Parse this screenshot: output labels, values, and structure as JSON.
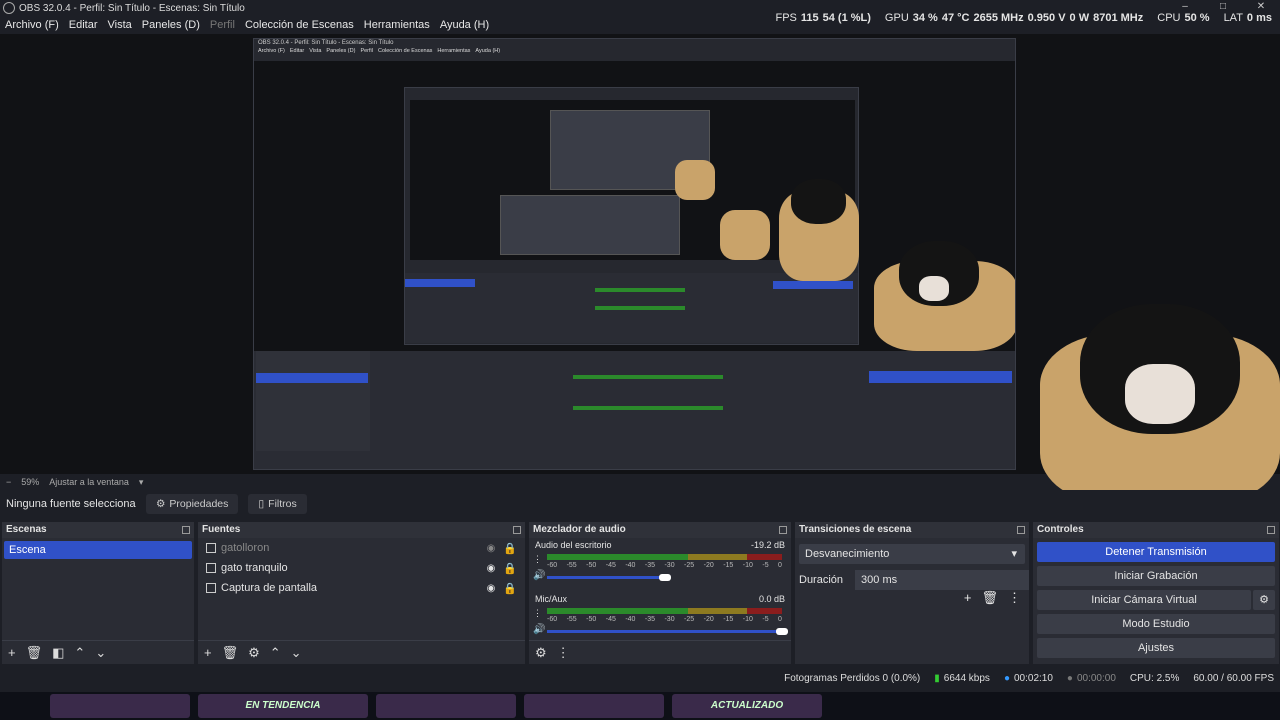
{
  "window": {
    "title": "OBS 32.0.4 - Perfil: Sin Título - Escenas: Sin Título",
    "min": "–",
    "max": "□",
    "close": "✕"
  },
  "menu": [
    "Archivo (F)",
    "Editar",
    "Vista",
    "Paneles (D)",
    "Perfil",
    "Colección de Escenas",
    "Herramientas",
    "Ayuda (H)"
  ],
  "stats": {
    "fps_label": "FPS",
    "fps_value": "115",
    "fps_extra": "54 (1 %L)",
    "gpu_label": "GPU",
    "gpu_value": "34 %",
    "gpu_temp": "47 °C",
    "gpu_clock": "2655 MHz",
    "gpu_volt": "0.950 V",
    "gpu_watt": "0 W",
    "gpu_mem": "8701 MHz",
    "cpu_label": "CPU",
    "cpu_value": "50 %",
    "lat_label": "LAT",
    "lat_value": "0 ms"
  },
  "zoom": {
    "minus": "−",
    "value": "59%",
    "fit": "Ajustar a la ventana"
  },
  "propbar": {
    "selected": "Ninguna fuente seleccionac",
    "properties": "Propiedades",
    "filters": "Filtros"
  },
  "scenes": {
    "title": "Escenas",
    "items": [
      "Escena"
    ]
  },
  "sources": {
    "title": "Fuentes",
    "items": [
      "gatolloron",
      "gato tranquilo",
      "Captura de pantalla"
    ]
  },
  "mixer": {
    "title": "Mezclador de audio",
    "channels": [
      {
        "name": "Audio del escritorio",
        "db": "-19.2 dB",
        "level": 0.72,
        "volume": 0.5
      },
      {
        "name": "Mic/Aux",
        "db": "0.0 dB",
        "level": 0.76,
        "volume": 1.0
      }
    ],
    "scale": [
      "-60",
      "-55",
      "-50",
      "-45",
      "-40",
      "-35",
      "-30",
      "-25",
      "-20",
      "-15",
      "-10",
      "-5",
      "0"
    ]
  },
  "transitions": {
    "title": "Transiciones de escena",
    "selected": "Desvanecimiento",
    "duration_label": "Duración",
    "duration_value": "300 ms"
  },
  "controls": {
    "title": "Controles",
    "buttons": [
      "Detener Transmisión",
      "Iniciar Grabación",
      "Iniciar Cámara Virtual",
      "Modo Estudio",
      "Ajustes"
    ]
  },
  "status": {
    "dropped": "Fotogramas Perdidos 0 (0.0%)",
    "bitrate": "6644 kbps",
    "stream_time": "00:02:10",
    "rec_time": "00:00:00",
    "cpu": "CPU: 2.5%",
    "fps": "60.00 / 60.00 FPS"
  },
  "taskbar": [
    "",
    "EN TENDENCIA",
    "",
    "",
    "ACTUALIZADO"
  ]
}
